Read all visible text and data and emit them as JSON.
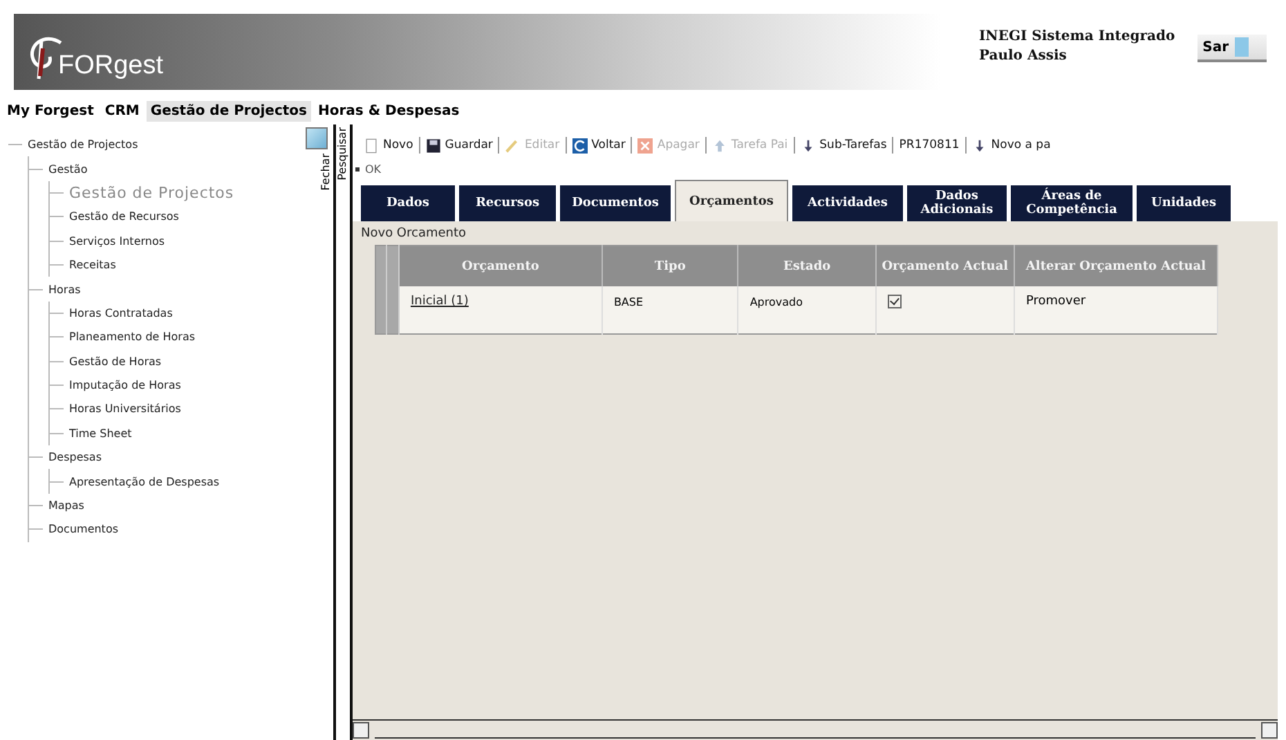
{
  "header": {
    "logo": "FORgest",
    "organization": "INEGI Sistema Integrado",
    "user": "Paulo Assis",
    "exit_button": "Sar"
  },
  "menu": [
    {
      "label": "My Forgest",
      "selected": false
    },
    {
      "label": "CRM",
      "selected": false
    },
    {
      "label": "Gestão de Projectos",
      "selected": true
    },
    {
      "label": "Horas & Despesas",
      "selected": false
    }
  ],
  "sidebar": {
    "items": [
      {
        "label": "Gestão de Projectos",
        "selected": false,
        "children": [
          {
            "label": "Gestão",
            "selected": false,
            "children": [
              {
                "label": "Gestão de Projectos",
                "selected": true
              },
              {
                "label": "Gestão de Recursos",
                "selected": false
              },
              {
                "label": "Serviços Internos",
                "selected": false
              },
              {
                "label": "Receitas",
                "selected": false
              }
            ]
          },
          {
            "label": "Horas",
            "selected": false,
            "children": [
              {
                "label": "Horas Contratadas",
                "selected": false
              },
              {
                "label": "Planeamento de Horas",
                "selected": false
              },
              {
                "label": "Gestão de Horas",
                "selected": false
              },
              {
                "label": "Imputação de Horas",
                "selected": false
              },
              {
                "label": "Horas Universitários",
                "selected": false
              },
              {
                "label": "Time Sheet",
                "selected": false
              }
            ]
          },
          {
            "label": "Despesas",
            "selected": false,
            "children": [
              {
                "label": "Apresentação de Despesas",
                "selected": false
              }
            ]
          },
          {
            "label": "Mapas",
            "selected": false
          },
          {
            "label": "Documentos",
            "selected": false
          }
        ]
      }
    ]
  },
  "side_tabs": [
    "Fechar",
    "Pesquisar"
  ],
  "toolbar": [
    {
      "label": "Novo",
      "kind": "new",
      "disabled": false
    },
    {
      "label": "Guardar",
      "kind": "save",
      "disabled": false
    },
    {
      "label": "Editar",
      "kind": "edit",
      "disabled": true
    },
    {
      "label": "Voltar",
      "kind": "back",
      "disabled": false
    },
    {
      "label": "Apagar",
      "kind": "delete",
      "disabled": true
    },
    {
      "label": "Tarefa Pai",
      "kind": "parent",
      "disabled": true
    },
    {
      "label": "Sub-Tarefas",
      "kind": "children",
      "disabled": false
    },
    {
      "label": "PR170811",
      "kind": "text",
      "disabled": false
    },
    {
      "label": "Novo a pa",
      "kind": "children",
      "disabled": false
    }
  ],
  "status": "OK",
  "tabs": [
    {
      "label": "Dados",
      "selected": false
    },
    {
      "label": "Recursos",
      "selected": false
    },
    {
      "label": "Documentos",
      "selected": false
    },
    {
      "label": "Orçamentos",
      "selected": true
    },
    {
      "label": "Actividades",
      "selected": false
    },
    {
      "label": "Dados Adicionais",
      "selected": false
    },
    {
      "label": "Áreas de Competência",
      "selected": false
    },
    {
      "label": "Unidades",
      "selected": false
    }
  ],
  "section_title": "Novo Orcamento",
  "table": {
    "columns": [
      "Orçamento",
      "Tipo",
      "Estado",
      "Orçamento Actual",
      "Alterar Orçamento Actual"
    ],
    "rows": [
      {
        "orcamento": "Inicial (1)",
        "tipo": "BASE",
        "estado": "Aprovado",
        "actual": true,
        "alterar": "Promover"
      }
    ]
  }
}
